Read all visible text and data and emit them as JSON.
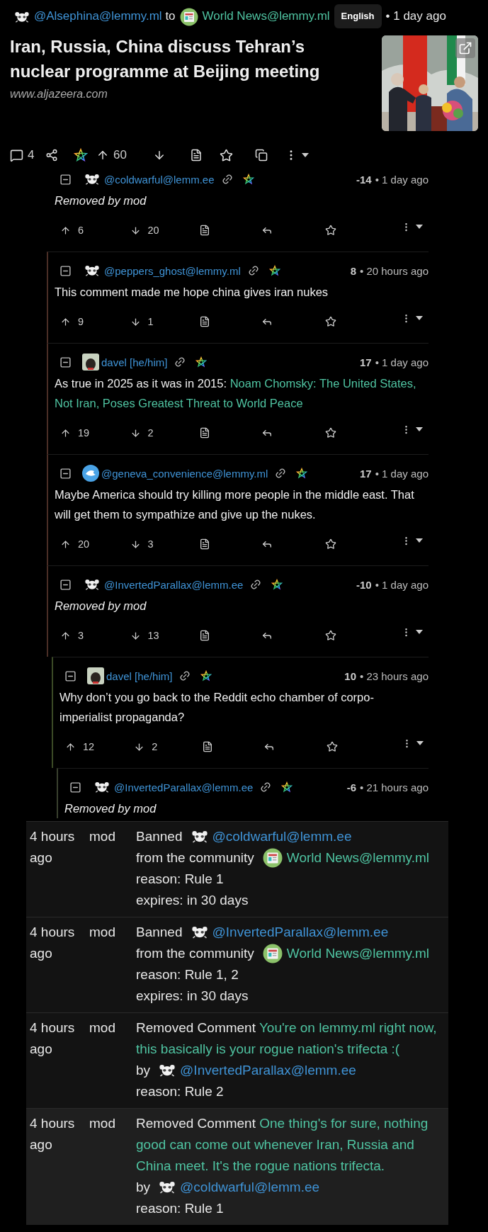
{
  "post": {
    "author": "@Alsephina@lemmy.ml",
    "to": "to",
    "community": "World News@lemmy.ml",
    "language": "English",
    "time": "• 1 day ago",
    "title": "Iran, Russia, China discuss Tehran’s nuclear programme at Beijing meeting",
    "url": "www.aljazeera.com",
    "comments": "4",
    "score": "60"
  },
  "comments": [
    {
      "author": "@coldwarful@lemm.ee",
      "avatar": {
        "kind": "mascot"
      },
      "score": "-14",
      "time": "• 1 day ago",
      "removed": true,
      "body": "Removed by mod",
      "up": "6",
      "down": "20",
      "children": [
        {
          "author": "@peppers_ghost@lemmy.ml",
          "avatar": {
            "kind": "mascot"
          },
          "score": "8",
          "time": "• 20 hours ago",
          "removed": false,
          "body": "This comment made me hope china gives iran nukes",
          "up": "9",
          "down": "1"
        },
        {
          "author": "davel [he/him]",
          "avatar": {
            "kind": "dog"
          },
          "score": "17",
          "time": "• 1 day ago",
          "removed": false,
          "body": "As true in 2025 as it was in 2015:",
          "link": "Noam Chomsky: The United States, Not Iran, Poses Greatest Threat to World Peace",
          "up": "19",
          "down": "2"
        },
        {
          "author": "@geneva_convenience@lemmy.ml",
          "avatar": {
            "kind": "dove"
          },
          "score": "17",
          "time": "• 1 day ago",
          "removed": false,
          "body": "Maybe America should try killing more people in the middle east. That will get them to sympathize and give up the nukes.",
          "up": "20",
          "down": "3"
        },
        {
          "author": "@InvertedParallax@lemm.ee",
          "avatar": {
            "kind": "mascot"
          },
          "score": "-10",
          "time": "• 1 day ago",
          "removed": true,
          "body": "Removed by mod",
          "up": "3",
          "down": "13",
          "children": [
            {
              "author": "davel [he/him]",
              "avatar": {
                "kind": "dog"
              },
              "score": "10",
              "time": "• 23 hours ago",
              "removed": false,
              "body": "Why don’t you go back to the Reddit echo chamber of corpo-imperialist propaganda?",
              "up": "12",
              "down": "2",
              "children": [
                {
                  "author": "@InvertedParallax@lemm.ee",
                  "avatar": {
                    "kind": "mascot"
                  },
                  "score": "-6",
                  "time": "• 21 hours ago",
                  "removed": true,
                  "body": "Removed by mod"
                }
              ]
            }
          ]
        }
      ]
    }
  ],
  "modlog": [
    {
      "time": "4 hours ago",
      "mod": "mod",
      "kind": "ban",
      "verb": "Banned",
      "user": "@coldwarful@lemm.ee",
      "preposition": "from the community",
      "community": "World News@lemmy.ml",
      "reason": "reason: Rule 1",
      "expires": "expires: in 30 days"
    },
    {
      "time": "4 hours ago",
      "mod": "mod",
      "kind": "ban",
      "verb": "Banned",
      "user": "@InvertedParallax@lemm.ee",
      "preposition": "from the community",
      "community": "World News@lemmy.ml",
      "reason": "reason: Rule 1, 2",
      "expires": "expires: in 30 days"
    },
    {
      "time": "4 hours ago",
      "mod": "mod",
      "kind": "remove_comment",
      "verb": "Removed Comment",
      "comment": "You're on lemmy.ml right now, this basically is your rogue nation's trifecta :(",
      "by": "by",
      "user": "@InvertedParallax@lemm.ee",
      "reason": "reason: Rule 2"
    },
    {
      "time": "4 hours ago",
      "mod": "mod",
      "kind": "remove_comment",
      "verb": "Removed Comment",
      "comment": "One thing's for sure, nothing good can come out whenever Iran, Russia and China meet. It's the rogue nations trifecta.",
      "by": "by",
      "user": "@coldwarful@lemm.ee",
      "reason": "reason: Rule 1"
    }
  ]
}
